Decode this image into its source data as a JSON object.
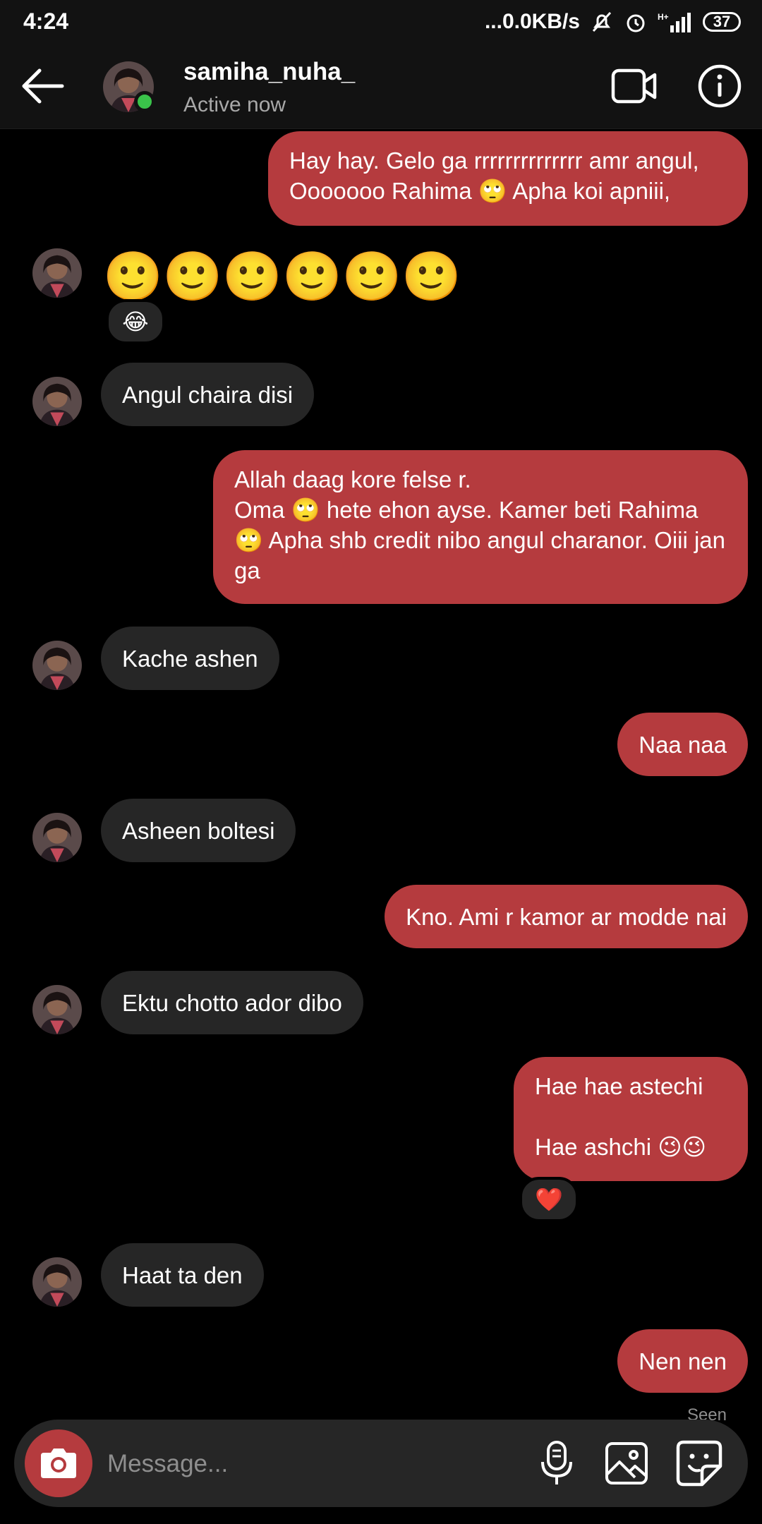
{
  "status_bar": {
    "time": "4:24",
    "network_speed": "...0.0KB/s",
    "battery": "37"
  },
  "header": {
    "username": "samiha_nuha_",
    "status": "Active now"
  },
  "messages": [
    {
      "side": "out",
      "text": "Hay hay. Gelo ga rrrrrrrrrrrrrr amr angul,\nOoooooo Rahima 🙄 Apha koi apniii,"
    },
    {
      "side": "in",
      "text": "🙂🙂🙂🙂🙂🙂",
      "reaction": "😂"
    },
    {
      "side": "in",
      "text": "Angul chaira disi"
    },
    {
      "side": "out",
      "text": "Allah daag kore felse r.\nOma 🙄 hete ehon ayse. Kamer beti Rahima 🙄 Apha shb credit nibo angul charanor. Oiii jan ga"
    },
    {
      "side": "in",
      "text": "Kache ashen"
    },
    {
      "side": "out",
      "text": "Naa naa"
    },
    {
      "side": "in",
      "text": "Asheen boltesi"
    },
    {
      "side": "out",
      "text": "Kno. Ami r kamor ar modde nai"
    },
    {
      "side": "in",
      "text": "Ektu chotto ador dibo"
    },
    {
      "side": "out",
      "text": "Hae hae astechi\n\nHae ashchi 😉😉",
      "reaction": "❤️"
    },
    {
      "side": "in",
      "text": "Haat ta den"
    },
    {
      "side": "out",
      "text": "Nen nen"
    }
  ],
  "seen_label": "Seen",
  "composer": {
    "placeholder": "Message..."
  },
  "colors": {
    "outgoing_bubble": "#b53b3e",
    "incoming_bubble": "#262626",
    "online": "#3ac34a"
  },
  "icons": [
    "back-arrow-icon",
    "video-call-icon",
    "info-icon",
    "camera-icon",
    "microphone-icon",
    "gallery-icon",
    "sticker-icon"
  ]
}
